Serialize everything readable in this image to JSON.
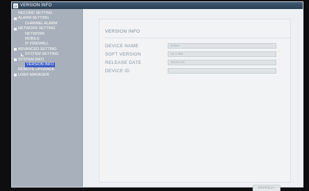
{
  "window": {
    "title": "VERSION INFO"
  },
  "sidebar": {
    "items": [
      {
        "label": "RECORD SETTING",
        "level": 0,
        "kind": "leaf"
      },
      {
        "label": "ALARM SETTING",
        "level": 0,
        "kind": "group"
      },
      {
        "label": "CHANNEL ALARM",
        "level": 1,
        "kind": "leaf"
      },
      {
        "label": "NETWORK SETTING",
        "level": 0,
        "kind": "group"
      },
      {
        "label": "NETWORK",
        "level": 1,
        "kind": "leaf"
      },
      {
        "label": "MOBILE",
        "level": 1,
        "kind": "leaf"
      },
      {
        "label": "IP FIREWALL",
        "level": 1,
        "kind": "leaf"
      },
      {
        "label": "ADVANCED SETTING",
        "level": 0,
        "kind": "group"
      },
      {
        "label": "SYSTEM SETTING",
        "level": 1,
        "kind": "leaf"
      },
      {
        "label": "SYSTEM INFO",
        "level": 0,
        "kind": "group"
      },
      {
        "label": "VERSION INFO",
        "level": 1,
        "kind": "leaf",
        "selected": true
      },
      {
        "label": "REMOTE UPGRADE",
        "level": 0,
        "kind": "leaf"
      },
      {
        "label": "USER MANAGER",
        "level": 0,
        "kind": "group"
      }
    ]
  },
  "main": {
    "section_title": "VERSION INFO",
    "fields": [
      {
        "label": "DEVICE NAME",
        "value": "Nvbox"
      },
      {
        "label": "SOFT VERSION",
        "value": "V1.1.800"
      },
      {
        "label": "RELEASE DATE",
        "value": "2019.6.20"
      },
      {
        "label": "DEVICE ID",
        "value": ""
      }
    ],
    "refresh_label": "REFRESH"
  },
  "colors": {
    "sidebar_bg": "#a8b1bb",
    "selection": "#3d5cc4",
    "content_bg": "#eef1f3",
    "titlebar": "#2c3f52"
  }
}
